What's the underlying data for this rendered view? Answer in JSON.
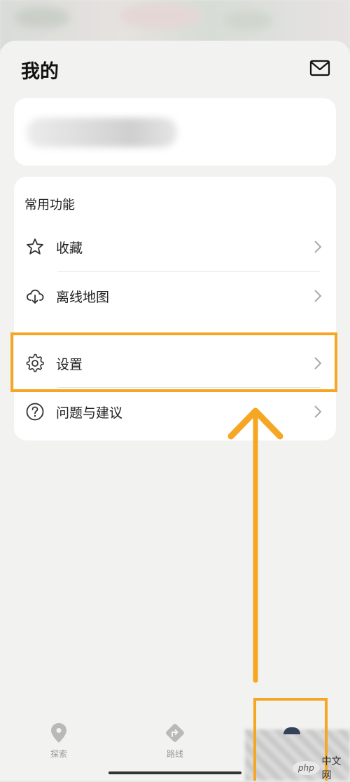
{
  "header": {
    "title": "我的",
    "mail_icon": "mail-icon"
  },
  "profile": {
    "name_blurred": true
  },
  "functions": {
    "section_title": "常用功能",
    "items": [
      {
        "label": "收藏",
        "icon": "star-icon"
      },
      {
        "label": "离线地图",
        "icon": "cloud-download-icon"
      },
      {
        "label": "设置",
        "icon": "gear-icon"
      },
      {
        "label": "问题与建议",
        "icon": "question-icon"
      }
    ]
  },
  "tabbar": {
    "tabs": [
      {
        "label": "探索",
        "icon": "location-pin-icon"
      },
      {
        "label": "路线",
        "icon": "route-icon"
      }
    ]
  },
  "watermark": {
    "logo_text": "php",
    "site_text": "中文网"
  },
  "colors": {
    "highlight": "#f5a623",
    "background": "#f2f3f1",
    "card": "#ffffff"
  }
}
